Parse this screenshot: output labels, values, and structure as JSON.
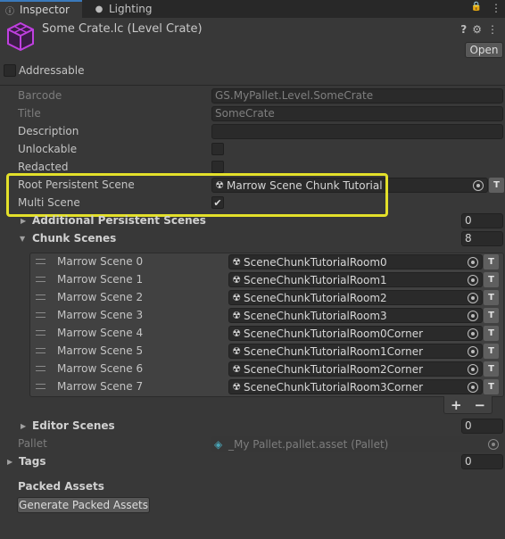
{
  "tabs": [
    {
      "label": "Inspector",
      "icon": "info-icon"
    },
    {
      "label": "Lighting",
      "icon": "lightbulb-icon"
    }
  ],
  "header": {
    "title": "Some Crate.lc (Level Crate)",
    "open_label": "Open",
    "icon_color": "#c040e0"
  },
  "addressable_label": "Addressable",
  "fields": {
    "barcode": {
      "label": "Barcode",
      "value": "GS.MyPallet.Level.SomeCrate"
    },
    "title": {
      "label": "Title",
      "value": "SomeCrate"
    },
    "description": {
      "label": "Description",
      "value": ""
    },
    "unlockable": {
      "label": "Unlockable",
      "checked": false
    },
    "redacted": {
      "label": "Redacted",
      "checked": false
    },
    "root_persistent_scene": {
      "label": "Root Persistent Scene",
      "value": "Marrow Scene Chunk Tutorial"
    },
    "multi_scene": {
      "label": "Multi Scene",
      "checked": true,
      "check": "✔"
    }
  },
  "additional_persistent_scenes": {
    "label": "Additional Persistent Scenes",
    "count": "0"
  },
  "chunk_scenes": {
    "label": "Chunk Scenes",
    "count": "8",
    "items": [
      {
        "label": "Marrow Scene 0",
        "value": "SceneChunkTutorialRoom0"
      },
      {
        "label": "Marrow Scene 1",
        "value": "SceneChunkTutorialRoom1"
      },
      {
        "label": "Marrow Scene 2",
        "value": "SceneChunkTutorialRoom2"
      },
      {
        "label": "Marrow Scene 3",
        "value": "SceneChunkTutorialRoom3"
      },
      {
        "label": "Marrow Scene 4",
        "value": "SceneChunkTutorialRoom0Corner"
      },
      {
        "label": "Marrow Scene 5",
        "value": "SceneChunkTutorialRoom1Corner"
      },
      {
        "label": "Marrow Scene 6",
        "value": "SceneChunkTutorialRoom2Corner"
      },
      {
        "label": "Marrow Scene 7",
        "value": "SceneChunkTutorialRoom3Corner"
      }
    ],
    "add_label": "+",
    "remove_label": "−"
  },
  "editor_scenes": {
    "label": "Editor Scenes",
    "count": "0"
  },
  "pallet": {
    "label": "Pallet",
    "value": "_My Pallet.pallet.asset (Pallet)"
  },
  "tags": {
    "label": "Tags",
    "count": "0"
  },
  "packed_assets": {
    "label": "Packed Assets",
    "button_label": "Generate Packed Assets"
  },
  "symbols": {
    "scene_icon": "☢",
    "t_button": "T",
    "fold_closed": "▶",
    "fold_open": "▼",
    "lock": "🔒",
    "menu": "⋮",
    "help": "?",
    "settings": "⚙",
    "link": "⇆",
    "pallet_icon": "◈"
  },
  "highlight_color": "#e3e02a"
}
